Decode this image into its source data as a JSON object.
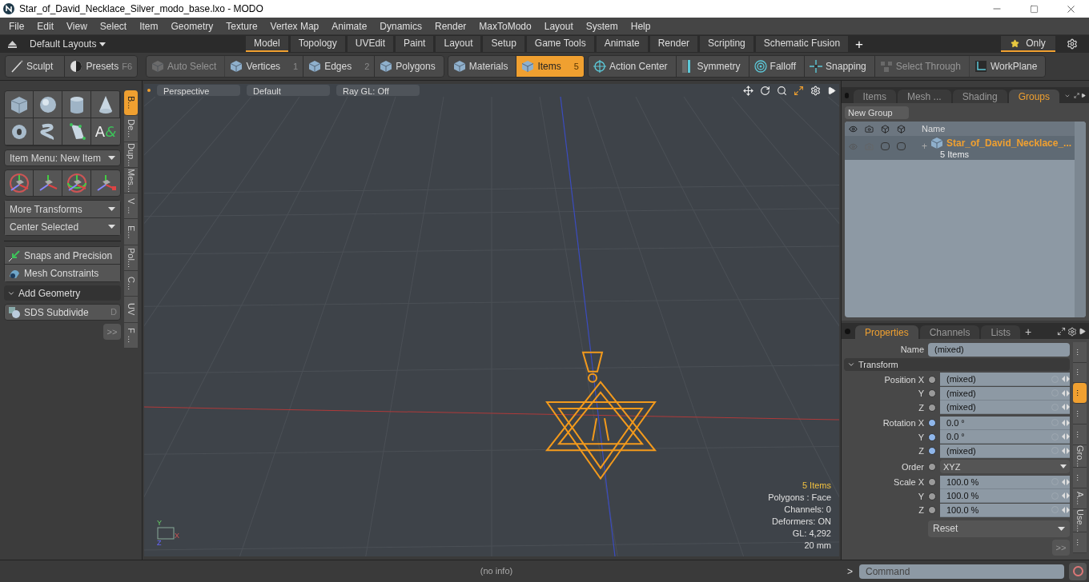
{
  "window": {
    "title": "Star_of_David_Necklace_Silver_modo_base.lxo - MODO"
  },
  "menu": [
    "File",
    "Edit",
    "View",
    "Select",
    "Item",
    "Geometry",
    "Texture",
    "Vertex Map",
    "Animate",
    "Dynamics",
    "Render",
    "MaxToModo",
    "Layout",
    "System",
    "Help"
  ],
  "layout_bar": {
    "layouts": "Default Layouts",
    "tabs": [
      {
        "label": "Model",
        "selected": true
      },
      {
        "label": "Topology",
        "selected": false
      },
      {
        "label": "UVEdit",
        "selected": false
      },
      {
        "label": "Paint",
        "selected": false
      },
      {
        "label": "Layout",
        "selected": false
      },
      {
        "label": "Setup",
        "selected": false
      },
      {
        "label": "Game Tools",
        "selected": false
      },
      {
        "label": "Animate",
        "selected": false
      },
      {
        "label": "Render",
        "selected": false
      },
      {
        "label": "Scripting",
        "selected": false
      },
      {
        "label": "Schematic Fusion",
        "selected": false
      }
    ],
    "add": "+",
    "only": "Only"
  },
  "toolbar": {
    "left": [
      {
        "label": "Sculpt"
      },
      {
        "label": "Presets",
        "shortcut": "F6"
      }
    ],
    "groups": [
      {
        "buttons": [
          {
            "label": "Auto Select",
            "disabled": true,
            "selected": false
          },
          {
            "label": "Vertices",
            "shortcut": "1",
            "disabled": false,
            "selected": false
          },
          {
            "label": "Edges",
            "shortcut": "2",
            "disabled": false,
            "selected": false
          },
          {
            "label": "Polygons",
            "disabled": false,
            "selected": false
          }
        ]
      },
      {
        "buttons": [
          {
            "label": "Materials",
            "disabled": false,
            "selected": false
          },
          {
            "label": "Items",
            "shortcut": "5",
            "disabled": false,
            "selected": true
          }
        ]
      },
      {
        "buttons": [
          {
            "label": "Action Center",
            "disabled": false,
            "selected": false
          },
          {
            "label": "Symmetry",
            "disabled": false,
            "selected": false
          },
          {
            "label": "Falloff",
            "disabled": false,
            "selected": false
          },
          {
            "label": "Snapping",
            "disabled": false,
            "selected": false
          },
          {
            "label": "Select Through",
            "disabled": true,
            "selected": false
          },
          {
            "label": "WorkPlane",
            "disabled": false,
            "selected": false
          }
        ]
      }
    ]
  },
  "left_panel": {
    "text_tool": {
      "letter": "A",
      "symbol": "&"
    },
    "item_menu": "Item Menu: New Item",
    "dropdowns": [
      "More Transforms",
      "Center Selected"
    ],
    "tools": [
      {
        "label": "Snaps and Precision"
      },
      {
        "label": "Mesh Constraints"
      }
    ],
    "section": {
      "label": "Add Geometry",
      "expanded": true
    },
    "sds": {
      "label": "SDS Subdivide",
      "shortcut": "D"
    },
    "more": ">>",
    "side_tabs": [
      {
        "label": "B...",
        "selected": true
      },
      {
        "label": "De...",
        "selected": false
      },
      {
        "label": "Dup...",
        "selected": false
      },
      {
        "label": "Mes...",
        "selected": false
      },
      {
        "label": "V ...",
        "selected": false
      },
      {
        "label": "E...",
        "selected": false
      },
      {
        "label": "Pol...",
        "selected": false
      },
      {
        "label": "C...",
        "selected": false
      },
      {
        "label": "UV",
        "selected": false
      },
      {
        "label": "F ...",
        "selected": false
      }
    ]
  },
  "viewport": {
    "header": [
      "Perspective",
      "Default",
      "Ray GL: Off"
    ],
    "axes": {
      "y": "Y",
      "x": "X",
      "z": "Z"
    },
    "info": [
      {
        "text": "5 Items",
        "highlight": true
      },
      {
        "text": "Polygons : Face",
        "highlight": false
      },
      {
        "text": "Channels: 0",
        "highlight": false
      },
      {
        "text": "Deformers: ON",
        "highlight": false
      },
      {
        "text": "GL: 4,292",
        "highlight": false
      },
      {
        "text": "20 mm",
        "highlight": false
      }
    ]
  },
  "groups_panel": {
    "tabs": [
      {
        "label": "Items",
        "selected": false
      },
      {
        "label": "Mesh ...",
        "selected": false
      },
      {
        "label": "Shading",
        "selected": false
      },
      {
        "label": "Groups",
        "selected": true
      }
    ],
    "new_group": "New Group",
    "name_column": "Name",
    "rows": [
      {
        "name": "Star_of_David_Necklace_...",
        "count": "5 Items",
        "expand": "+",
        "selected": true
      }
    ]
  },
  "properties_panel": {
    "tabs": [
      {
        "label": "Properties",
        "selected": true
      },
      {
        "label": "Channels",
        "selected": false
      },
      {
        "label": "Lists",
        "selected": false
      }
    ],
    "add": "+",
    "name_label": "Name",
    "name_value": "(mixed)",
    "section": {
      "label": "Transform",
      "expanded": true
    },
    "groups": [
      {
        "kind": "fields",
        "rows": [
          {
            "label": "Position X",
            "value": "(mixed)",
            "color": "#9a9a9a"
          },
          {
            "label": "Y",
            "value": "(mixed)",
            "color": "#9a9a9a"
          },
          {
            "label": "Z",
            "value": "(mixed)",
            "color": "#9a9a9a"
          }
        ]
      },
      {
        "kind": "fields",
        "rows": [
          {
            "label": "Rotation X",
            "value": "0.0 °",
            "color": "#8fb6ea"
          },
          {
            "label": "Y",
            "value": "0.0 °",
            "color": "#8fb6ea"
          },
          {
            "label": "Z",
            "value": "(mixed)",
            "color": "#8fb6ea"
          }
        ]
      },
      {
        "kind": "dropdown",
        "rows": [
          {
            "label": "Order",
            "value": "XYZ",
            "color": "#9a9a9a"
          }
        ]
      },
      {
        "kind": "fields",
        "rows": [
          {
            "label": "Scale X",
            "value": "100.0 %",
            "color": "#9a9a9a"
          },
          {
            "label": "Y",
            "value": "100.0 %",
            "color": "#9a9a9a"
          },
          {
            "label": "Z",
            "value": "100.0 %",
            "color": "#9a9a9a"
          }
        ]
      }
    ],
    "reset": "Reset",
    "more": ">>",
    "side_tabs": [
      {
        "label": "...",
        "selected": false
      },
      {
        "label": "...",
        "selected": false
      },
      {
        "label": "...",
        "selected": true
      },
      {
        "label": "...",
        "selected": false
      },
      {
        "label": "...",
        "selected": false
      },
      {
        "label": "Gro...",
        "selected": false
      },
      {
        "label": "...",
        "selected": false
      },
      {
        "label": "A...",
        "selected": false
      },
      {
        "label": "Use...",
        "selected": false
      },
      {
        "label": "...",
        "selected": false
      }
    ]
  },
  "status_bar": {
    "info": "(no info)",
    "prompt": ">",
    "command_placeholder": "Command"
  }
}
